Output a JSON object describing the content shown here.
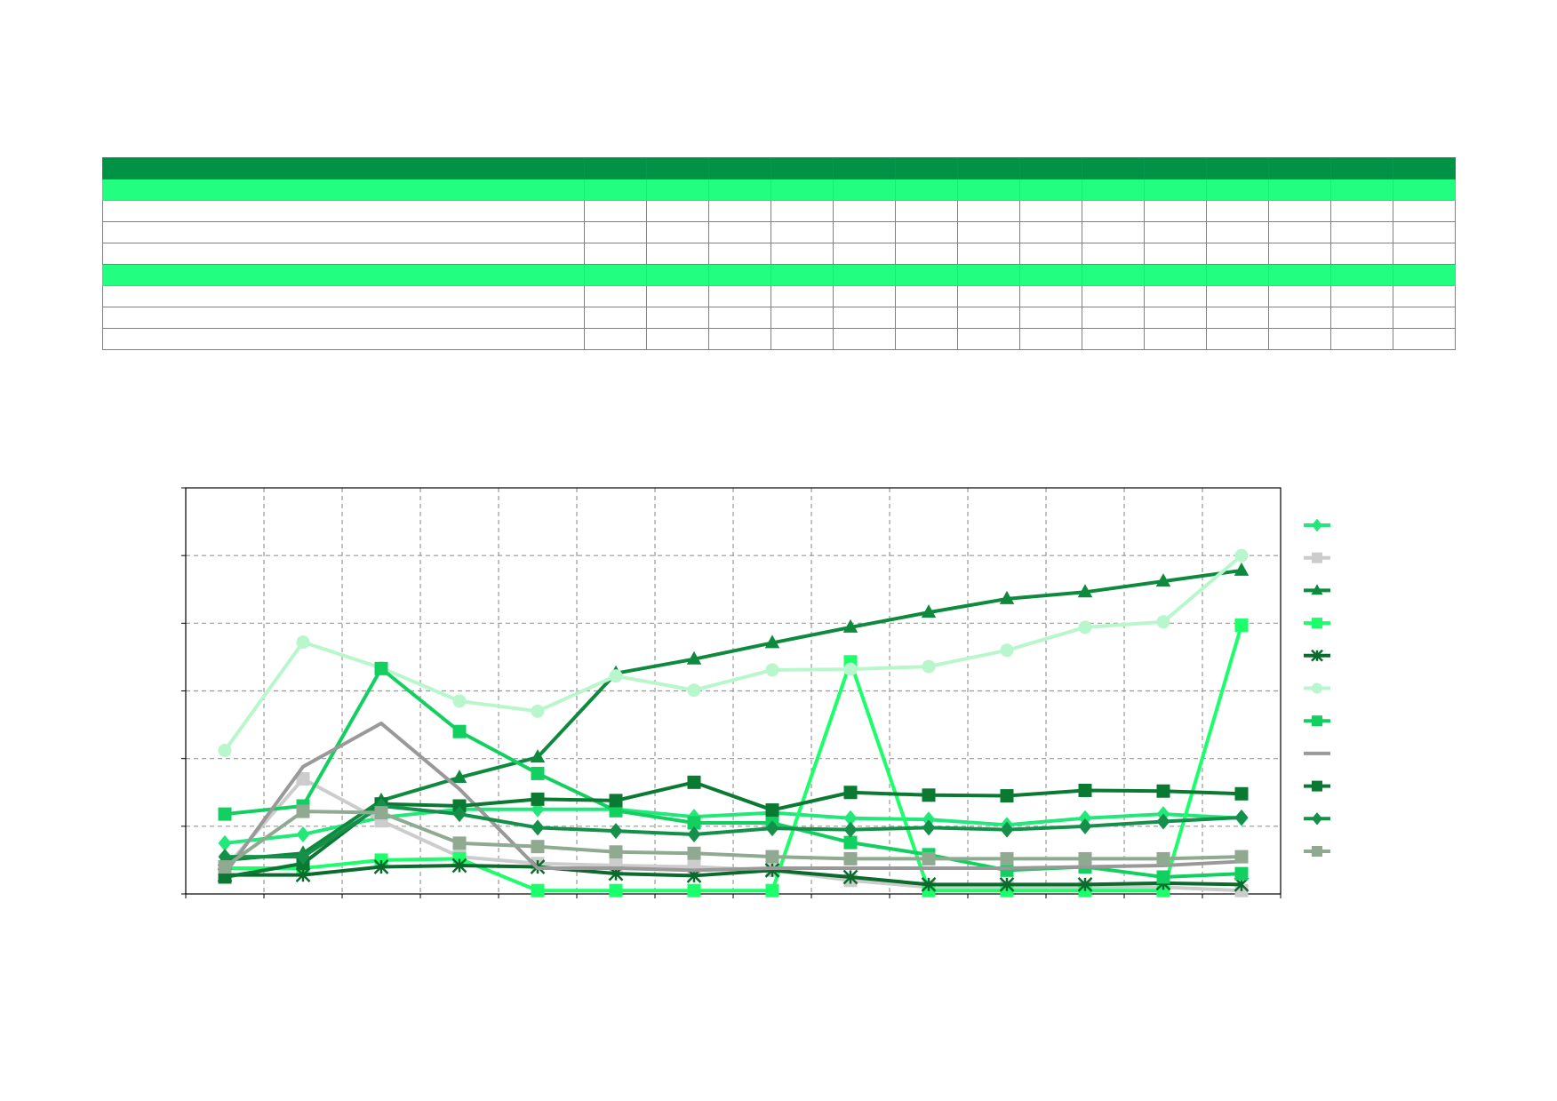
{
  "table": {
    "columns": 15,
    "rows": [
      {
        "style": "dark"
      },
      {
        "style": "light"
      },
      {
        "style": "blank"
      },
      {
        "style": "blank"
      },
      {
        "style": "blank"
      },
      {
        "style": "light"
      },
      {
        "style": "blank"
      },
      {
        "style": "blank"
      },
      {
        "style": "blank"
      }
    ]
  },
  "chart_data": {
    "type": "line",
    "title": "",
    "xlabel": "",
    "ylabel": "",
    "x": [
      1,
      2,
      3,
      4,
      5,
      6,
      7,
      8,
      9,
      10,
      11,
      12,
      13,
      14
    ],
    "xlim": [
      0.5,
      14.5
    ],
    "ylim": [
      0,
      6
    ],
    "grid": true,
    "legend": "right",
    "series": [
      {
        "color": "#22e87a",
        "marker": "diamond",
        "values": [
          0.75,
          0.88,
          1.13,
          1.25,
          1.25,
          1.25,
          1.14,
          1.2,
          1.12,
          1.1,
          1.02,
          1.12,
          1.18,
          1.12
        ]
      },
      {
        "color": "#cccccc",
        "marker": "square",
        "values": [
          0.38,
          1.7,
          1.08,
          0.55,
          0.45,
          0.42,
          0.4,
          0.35,
          0.2,
          0.1,
          0.1,
          0.1,
          0.1,
          0.05
        ]
      },
      {
        "color": "#0e8a3e",
        "marker": "triangle",
        "values": [
          0.5,
          0.6,
          1.38,
          1.72,
          2.02,
          3.26,
          3.47,
          3.71,
          3.94,
          4.16,
          4.36,
          4.46,
          4.62,
          4.78
        ]
      },
      {
        "color": "#1aff6a",
        "marker": "square",
        "values": [
          0.38,
          0.38,
          0.5,
          0.52,
          0.05,
          0.05,
          0.05,
          0.05,
          3.43,
          0.05,
          0.05,
          0.05,
          0.05,
          3.97
        ]
      },
      {
        "color": "#0a6b2c",
        "marker": "star",
        "values": [
          0.28,
          0.28,
          0.4,
          0.42,
          0.4,
          0.3,
          0.27,
          0.35,
          0.25,
          0.14,
          0.14,
          0.14,
          0.16,
          0.14
        ]
      },
      {
        "color": "#b8f7cc",
        "marker": "circle",
        "values": [
          2.12,
          3.72,
          3.34,
          2.85,
          2.7,
          3.22,
          3.01,
          3.31,
          3.32,
          3.36,
          3.6,
          3.94,
          4.02,
          5.0
        ]
      },
      {
        "color": "#12d060",
        "marker": "square",
        "values": [
          1.18,
          1.3,
          3.33,
          2.4,
          1.78,
          1.23,
          1.05,
          1.05,
          0.76,
          0.58,
          0.35,
          0.4,
          0.25,
          0.3
        ]
      },
      {
        "color": "#999999",
        "marker": "none",
        "values": [
          0.3,
          1.88,
          2.52,
          1.55,
          0.38,
          0.38,
          0.35,
          0.38,
          0.38,
          0.38,
          0.38,
          0.4,
          0.42,
          0.48
        ]
      },
      {
        "color": "#0a7a33",
        "marker": "square",
        "values": [
          0.25,
          0.45,
          1.33,
          1.3,
          1.4,
          1.38,
          1.65,
          1.24,
          1.5,
          1.46,
          1.45,
          1.53,
          1.52,
          1.48
        ]
      },
      {
        "color": "#15904a",
        "marker": "diamond",
        "values": [
          0.55,
          0.55,
          1.3,
          1.18,
          0.98,
          0.93,
          0.88,
          0.97,
          0.95,
          0.98,
          0.95,
          1.0,
          1.07,
          1.13
        ]
      },
      {
        "color": "#8faa90",
        "marker": "square",
        "values": [
          0.4,
          1.22,
          1.2,
          0.75,
          0.7,
          0.62,
          0.6,
          0.55,
          0.52,
          0.52,
          0.52,
          0.52,
          0.52,
          0.55
        ]
      }
    ]
  }
}
